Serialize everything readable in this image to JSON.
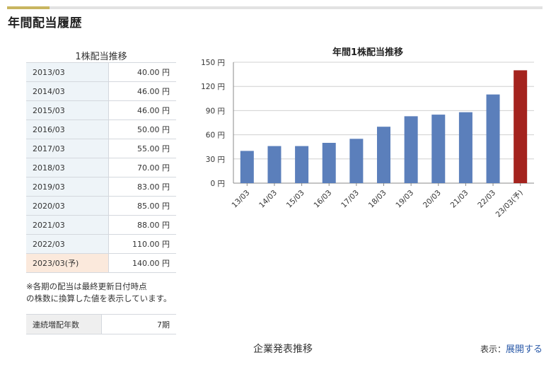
{
  "section": {
    "title": "年間配当履歴"
  },
  "dividend_table": {
    "caption": "1株配当推移",
    "rows": [
      {
        "year": "2013/03",
        "amount": "40.00 円"
      },
      {
        "year": "2014/03",
        "amount": "46.00 円"
      },
      {
        "year": "2015/03",
        "amount": "46.00 円"
      },
      {
        "year": "2016/03",
        "amount": "50.00 円"
      },
      {
        "year": "2017/03",
        "amount": "55.00 円"
      },
      {
        "year": "2018/03",
        "amount": "70.00 円"
      },
      {
        "year": "2019/03",
        "amount": "83.00 円"
      },
      {
        "year": "2020/03",
        "amount": "85.00 円"
      },
      {
        "year": "2021/03",
        "amount": "88.00 円"
      },
      {
        "year": "2022/03",
        "amount": "110.00 円"
      },
      {
        "year": "2023/03(予)",
        "amount": "140.00 円"
      }
    ]
  },
  "note": {
    "line1": "※各期の配当は最終更新日付時点",
    "line2": "の株数に換算した値を表示しています。"
  },
  "streak": {
    "label": "連続増配年数",
    "value": "7期"
  },
  "footer": {
    "company_trend": "企業発表推移",
    "display_label": "表示：",
    "expand_link": "展開する"
  },
  "colors": {
    "bar": "#5b7fbb",
    "bar_forecast": "#a4231e",
    "forecast_cell": "#fbe9dc",
    "year_cell": "#eef4f8",
    "accent": "#c8b560"
  },
  "chart_data": {
    "type": "bar",
    "title": "年間1株配当推移",
    "categories": [
      "13/03",
      "14/03",
      "15/03",
      "16/03",
      "17/03",
      "18/03",
      "19/03",
      "20/03",
      "21/03",
      "22/03",
      "23/03(予)"
    ],
    "values": [
      40,
      46,
      46,
      50,
      55,
      70,
      83,
      85,
      88,
      110,
      140
    ],
    "forecast_index": 10,
    "yticks": [
      "0 円",
      "30 円",
      "60 円",
      "90 円",
      "120 円",
      "150 円"
    ],
    "ylim": [
      0,
      150
    ],
    "grid": true,
    "xlabel": "",
    "ylabel": ""
  }
}
